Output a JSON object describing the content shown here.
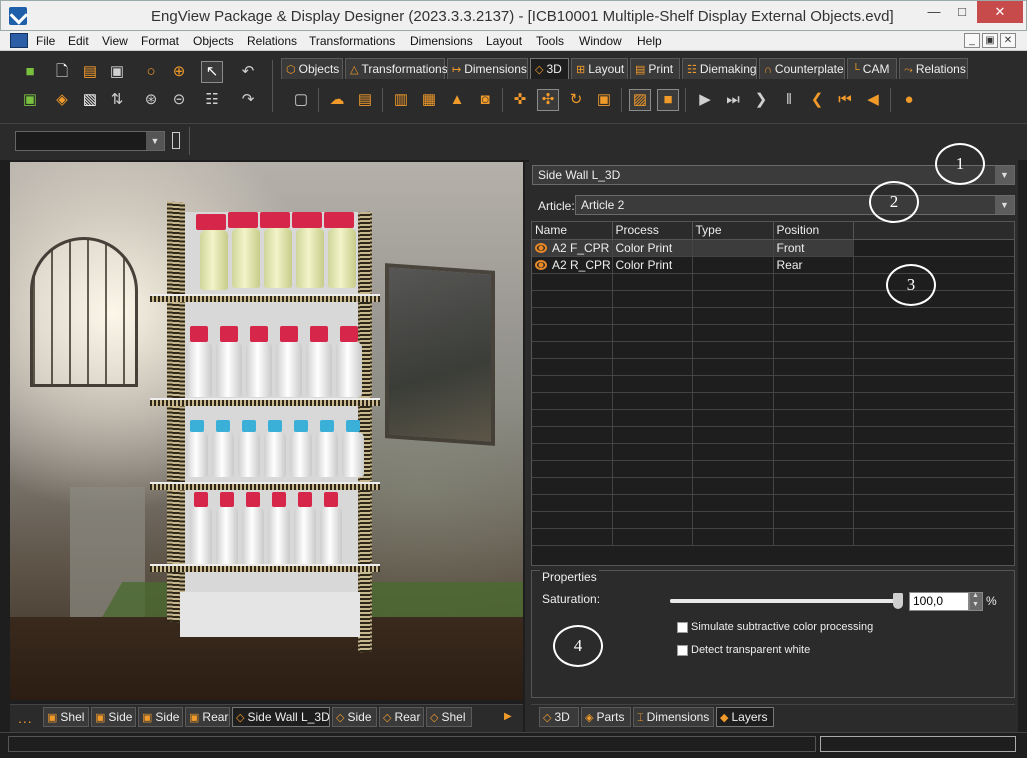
{
  "window": {
    "title": "EngView Package & Display Designer (2023.3.3.2137) - [ICB10001 Multiple-Shelf Display External Objects.evd]",
    "minimize": "—",
    "maximize": "□",
    "close": "✕"
  },
  "menu": {
    "items": [
      "File",
      "Edit",
      "View",
      "Format",
      "Objects",
      "Relations",
      "Transformations",
      "Dimensions",
      "Layout",
      "Tools",
      "Window",
      "Help"
    ],
    "mdi_buttons": [
      "_",
      "▣",
      "✕"
    ]
  },
  "toolbar_tabs": [
    {
      "label": "Objects",
      "icon": "objects-icon"
    },
    {
      "label": "Transformations",
      "icon": "transformations-icon"
    },
    {
      "label": "Dimensions",
      "icon": "dimensions-icon"
    },
    {
      "label": "3D",
      "icon": "cube-3d-icon",
      "active": true
    },
    {
      "label": "Layout",
      "icon": "layout-icon"
    },
    {
      "label": "Print",
      "icon": "print-icon"
    },
    {
      "label": "Diemaking",
      "icon": "diemaking-icon"
    },
    {
      "label": "Counterplate",
      "icon": "counterplate-icon"
    },
    {
      "label": "CAM",
      "icon": "cam-icon"
    },
    {
      "label": "Relations",
      "icon": "relations-icon"
    }
  ],
  "right_panel": {
    "part_select": "Side Wall L_3D",
    "article_label": "Article:",
    "article_select": "Article 2",
    "grid": {
      "columns": [
        "Name",
        "Process",
        "Type",
        "Position"
      ],
      "rows": [
        {
          "name": "A2 F_CPR",
          "process": "Color Print",
          "type": "",
          "position": "Front"
        },
        {
          "name": "A2 R_CPR",
          "process": "Color Print",
          "type": "",
          "position": "Rear"
        }
      ]
    },
    "properties": {
      "title": "Properties",
      "saturation_label": "Saturation:",
      "saturation_value": "100,0",
      "saturation_unit": "%",
      "saturation_level": 1.0,
      "simulate_label": "Simulate subtractive color processing",
      "simulate_checked": false,
      "transparent_label": "Detect transparent white",
      "transparent_checked": false
    }
  },
  "callouts": [
    "1",
    "2",
    "3",
    "4"
  ],
  "bottom_tabs_left": {
    "more": "...",
    "items": [
      "Shel",
      "Side",
      "Side",
      "Rear",
      "Side Wall L_3D",
      "Side",
      "Rear",
      "Shel"
    ]
  },
  "bottom_tabs_right": [
    "3D",
    "Parts",
    "Dimensions",
    "Layers"
  ],
  "colors": {
    "accent_orange": "#f09a2a",
    "panel_dark": "#2b2b2b",
    "grid_bg": "#1e1e1e"
  }
}
